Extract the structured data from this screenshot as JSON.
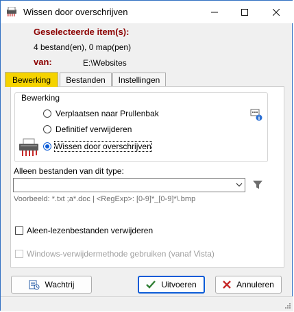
{
  "window": {
    "title": "Wissen door overschrijven"
  },
  "header": {
    "selected_label": "Geselecteerde item(s):",
    "selected_count": "4 bestand(en), 0 map(pen)",
    "from_label": "van:",
    "from_path": "E:\\Websites"
  },
  "tabs": [
    {
      "label": "Bewerking",
      "active": true
    },
    {
      "label": "Bestanden",
      "active": false
    },
    {
      "label": "Instellingen",
      "active": false
    }
  ],
  "operation": {
    "group_title": "Bewerking",
    "options": [
      {
        "label": "Verplaatsen naar Prullenbak",
        "selected": false
      },
      {
        "label": "Definitief verwijderen",
        "selected": false
      },
      {
        "label": "Wissen door overschrijven",
        "selected": true
      }
    ]
  },
  "filter": {
    "label": "Alleen bestanden van dit type:",
    "value": "",
    "hint": "Voorbeeld: *.txt ;a*.doc | <RegExp>: [0-9]*_[0-9]*\\.bmp"
  },
  "checkboxes": {
    "readonly": {
      "label": "Aleen-lezenbestanden verwijderen",
      "checked": false,
      "enabled": true
    },
    "windows_method": {
      "label": "Windows-verwijdermethode gebruiken (vanaf Vista)",
      "checked": false,
      "enabled": false
    }
  },
  "buttons": {
    "queue": "Wachtrij",
    "execute": "Uitvoeren",
    "cancel": "Annuleren"
  },
  "colors": {
    "accent": "#0a5bd7",
    "tab_active": "#f5d300",
    "label_red": "#8b0000"
  }
}
